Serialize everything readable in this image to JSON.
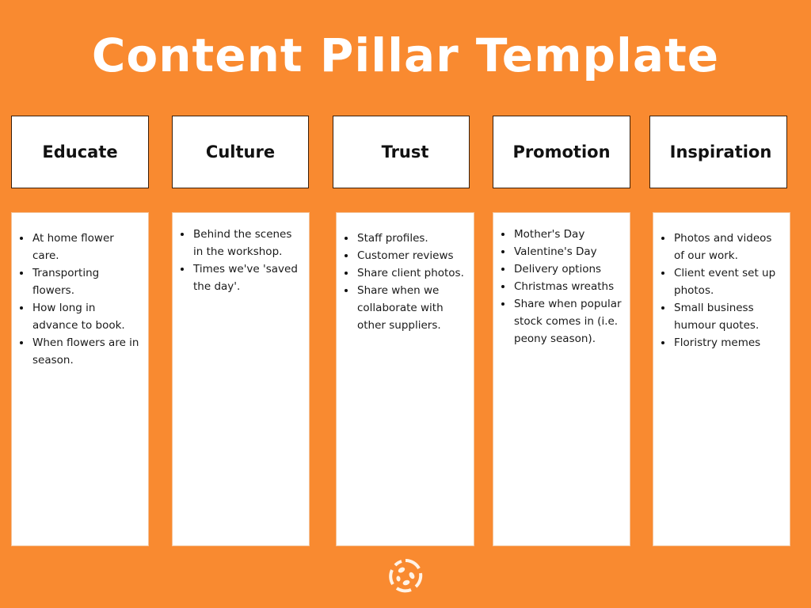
{
  "title": "Content Pillar Template",
  "colors": {
    "background": "#f98a30",
    "card": "#ffffff",
    "text": "#111111"
  },
  "pillars": [
    {
      "heading": "Educate",
      "items": [
        "At home flower care.",
        "Transporting flowers.",
        "How long in advance to book.",
        "When flowers are in season."
      ]
    },
    {
      "heading": "Culture",
      "items": [
        "Behind the scenes in the workshop.",
        "Times we've 'saved the day'."
      ]
    },
    {
      "heading": "Trust",
      "items": [
        "Staff profiles.",
        "Customer reviews",
        "Share client photos.",
        "Share when we collaborate with other suppliers."
      ]
    },
    {
      "heading": "Promotion",
      "items": [
        "Mother's Day",
        "Valentine's Day",
        "Delivery options",
        "Christmas wreaths",
        "Share when popular stock comes in (i.e. peony season)."
      ]
    },
    {
      "heading": "Inspiration",
      "items": [
        "Photos and videos of our work.",
        "Client event set up photos.",
        "Small business humour quotes.",
        "Floristry memes"
      ]
    }
  ],
  "footer": {
    "logo_icon": "circular-brand-logo-icon"
  }
}
